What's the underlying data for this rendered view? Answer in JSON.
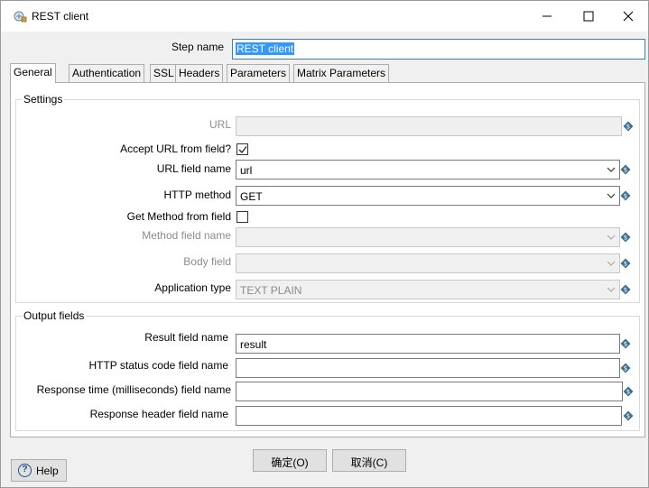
{
  "window": {
    "title": "REST client",
    "app_icon": "kettle-step-icon"
  },
  "step": {
    "label": "Step name",
    "value": "REST client"
  },
  "tabs": [
    {
      "label": "General",
      "active": true
    },
    {
      "label": "Authentication"
    },
    {
      "label": "SSL"
    },
    {
      "label": "Headers"
    },
    {
      "label": "Parameters"
    },
    {
      "label": "Matrix Parameters"
    }
  ],
  "settings": {
    "title": "Settings",
    "url": {
      "label": "URL",
      "value": ""
    },
    "accept_url": {
      "label": "Accept URL from field?",
      "checked": true
    },
    "url_field_name": {
      "label": "URL field name",
      "value": "url"
    },
    "http_method": {
      "label": "HTTP method",
      "value": "GET"
    },
    "get_method": {
      "label": "Get Method from field",
      "checked": false
    },
    "method_field_name": {
      "label": "Method field name",
      "value": ""
    },
    "body_field": {
      "label": "Body field",
      "value": ""
    },
    "application_type": {
      "label": "Application type",
      "value": "TEXT PLAIN"
    }
  },
  "output": {
    "title": "Output fields",
    "result_field": {
      "label": "Result field name",
      "value": "result"
    },
    "status_field": {
      "label": "HTTP status code field name",
      "value": ""
    },
    "response_time_field": {
      "label": "Response time (milliseconds) field name",
      "value": ""
    },
    "response_header_field": {
      "label": "Response header field name",
      "value": ""
    }
  },
  "buttons": {
    "help": "Help",
    "ok": "确定(O)",
    "cancel": "取消(C)"
  },
  "colors": {
    "accent": "#3399ff",
    "variable_icon": "#3c6e8f"
  }
}
